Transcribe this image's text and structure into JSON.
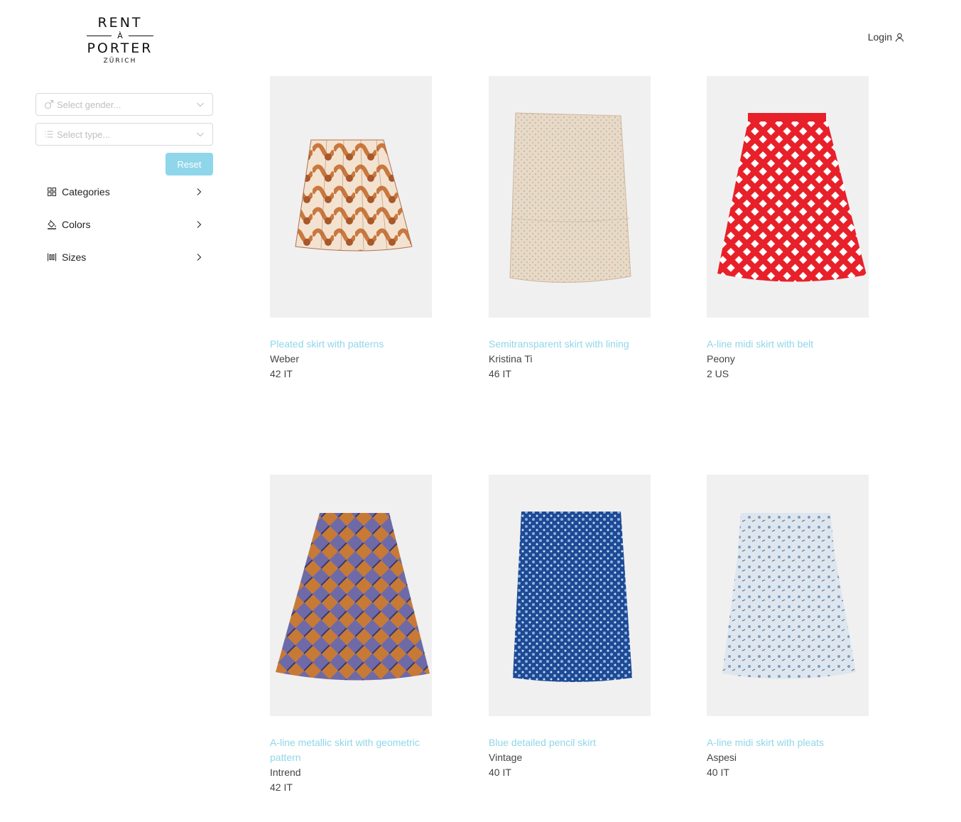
{
  "logo": {
    "line1": "RENT",
    "line2": "À",
    "line3": "PORTER",
    "line4": "ZÜRICH"
  },
  "header": {
    "login_label": "Login",
    "login_icon": "user-icon"
  },
  "filters": {
    "gender_placeholder": "Select gender...",
    "type_placeholder": "Select type...",
    "reset_label": "Reset"
  },
  "menu": {
    "items": [
      {
        "label": "Categories",
        "icon": "grid-icon"
      },
      {
        "label": "Colors",
        "icon": "paint-bucket-icon"
      },
      {
        "label": "Sizes",
        "icon": "column-width-icon"
      }
    ]
  },
  "products": [
    {
      "title": "Pleated skirt with patterns",
      "brand": "Weber",
      "size": "42 IT",
      "colors": [
        "#c9783e",
        "#f3e2cf"
      ]
    },
    {
      "title": "Semitransparent skirt with lining",
      "brand": "Kristina Ti",
      "size": "46 IT",
      "colors": [
        "#e8d8c4",
        "#cdb9a0"
      ]
    },
    {
      "title": "A-line midi skirt with belt",
      "brand": "Peony",
      "size": "2 US",
      "colors": [
        "#e8202a",
        "#ffffff"
      ]
    },
    {
      "title": "A-line metallic skirt with geometric pattern",
      "brand": "Intrend",
      "size": "42 IT",
      "colors": [
        "#6e6aa8",
        "#c77a36"
      ]
    },
    {
      "title": "Blue detailed pencil skirt",
      "brand": "Vintage",
      "size": "40 IT",
      "colors": [
        "#1d4a95",
        "#8fb0e0"
      ]
    },
    {
      "title": "A-line midi skirt with pleats",
      "brand": "Aspesi",
      "size": "40 IT",
      "colors": [
        "#dde6ef",
        "#7f9ab5"
      ]
    }
  ]
}
